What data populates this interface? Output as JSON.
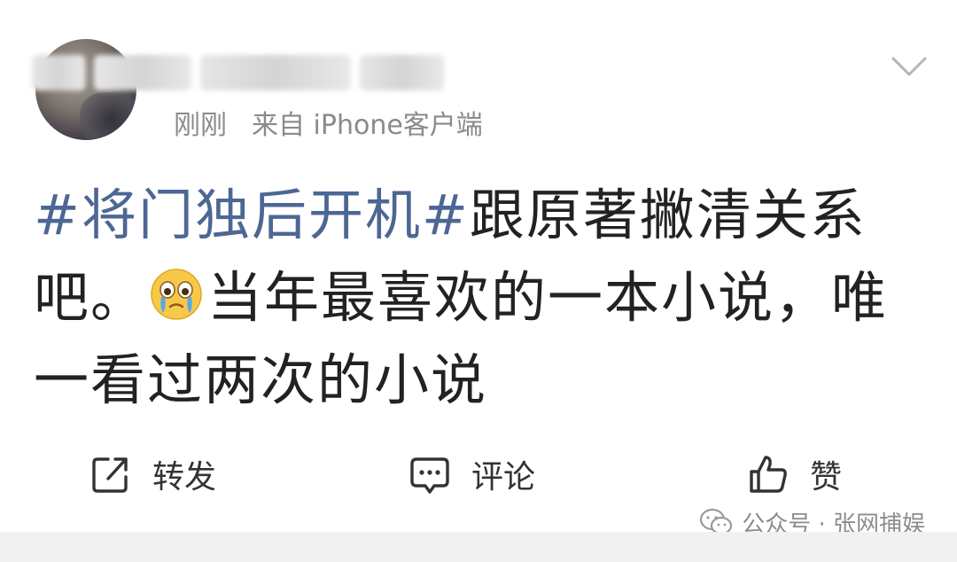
{
  "header": {
    "time": "刚刚",
    "source": "来自 iPhone客户端"
  },
  "post": {
    "hashtag": "#将门独后开机#",
    "text_part1": "跟原著撇清关系吧。",
    "emoji": "crying-face-emoji",
    "text_part2": "当年最喜欢的一本小说，唯一看过两次的小说"
  },
  "actions": {
    "repost": "转发",
    "comment": "评论",
    "like": "赞"
  },
  "watermark": {
    "text": "公众号 · 张网捕娱"
  },
  "colors": {
    "hashtag": "#4d6794",
    "body_text": "#222222",
    "meta_text": "#8a8a8a"
  }
}
